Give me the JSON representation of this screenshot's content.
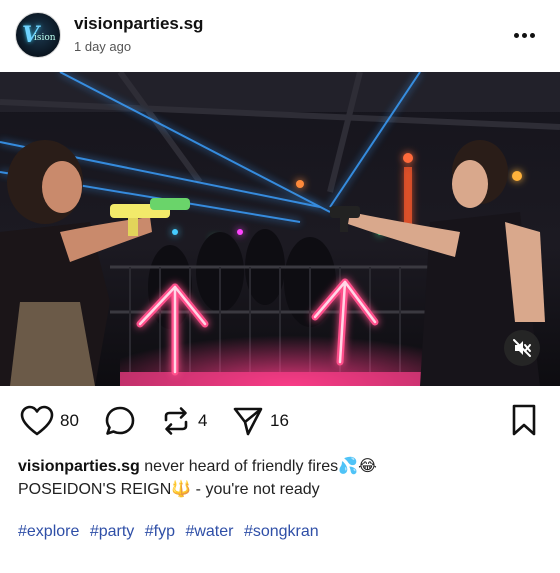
{
  "header": {
    "username": "visionparties.sg",
    "time": "1 day ago",
    "avatar_logo_text": "Vision"
  },
  "media": {
    "mute_icon": "speaker-muted-icon"
  },
  "actions": {
    "likes": "80",
    "reposts": "4",
    "shares": "16"
  },
  "caption": {
    "username": "visionparties.sg",
    "line1": "never heard of friendly fires💦😂",
    "line2": "POSEIDON'S REIGN🔱 - you're not ready"
  },
  "hashtags": [
    "#explore",
    "#party",
    "#fyp",
    "#water",
    "#songkran"
  ],
  "colors": {
    "hashtag": "#2f4fa7",
    "neon_arrow": "#ff4f8b",
    "laser": "#3aa0ff"
  }
}
